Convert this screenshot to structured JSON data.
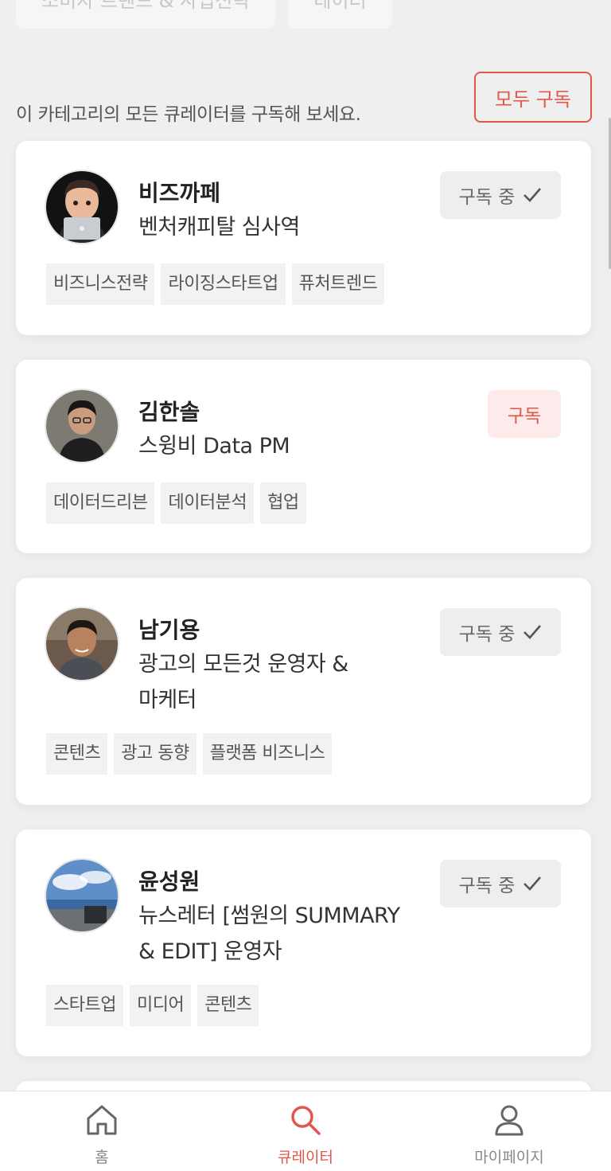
{
  "top_chips": [
    "소비자 트렌드 & 사업전략",
    "데이터"
  ],
  "intro": {
    "text": "이 카테고리의 모든 큐레이터를 구독해 보세요.",
    "subscribe_all_label": "모두 구독"
  },
  "curators": [
    {
      "name": "비즈까페",
      "title_lines": [
        "벤처캐피탈 심사역"
      ],
      "subscribed": true,
      "button_label": "구독 중",
      "tags": [
        "비즈니스전략",
        "라이징스타트업",
        "퓨처트렌드"
      ]
    },
    {
      "name": "김한솔",
      "title_lines": [
        "스윙비 Data PM"
      ],
      "subscribed": false,
      "button_label": "구독",
      "tags": [
        "데이터드리븐",
        "데이터분석",
        "협업"
      ]
    },
    {
      "name": "남기용",
      "title_lines": [
        "광고의 모든것 운영자 &",
        "마케터"
      ],
      "subscribed": true,
      "button_label": "구독 중",
      "tags": [
        "콘텐츠",
        "광고 동향",
        "플랫폼 비즈니스"
      ]
    },
    {
      "name": "윤성원",
      "title_lines": [
        "뉴스레터 [썸원의 SUMMARY",
        "& EDIT] 운영자"
      ],
      "subscribed": true,
      "button_label": "구독 중",
      "tags": [
        "스타트업",
        "미디어",
        "콘텐츠"
      ]
    }
  ],
  "bottom_nav": [
    {
      "label": "홈",
      "icon": "home-icon",
      "active": false
    },
    {
      "label": "큐레이터",
      "icon": "search-icon",
      "active": true
    },
    {
      "label": "마이페이지",
      "icon": "user-icon",
      "active": false
    }
  ],
  "colors": {
    "accent": "#e0584b",
    "background": "#efefef"
  }
}
